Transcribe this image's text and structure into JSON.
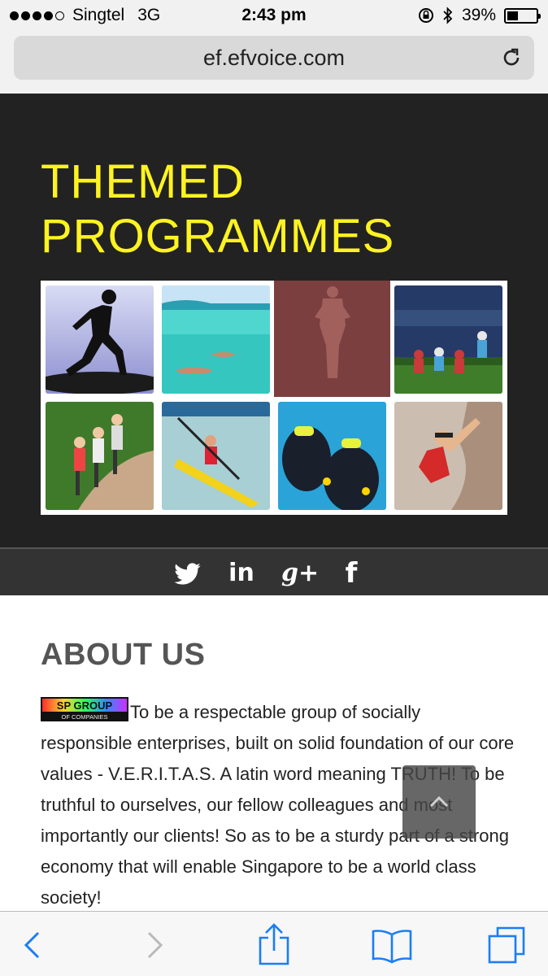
{
  "status_bar": {
    "carrier": "Singtel",
    "network": "3G",
    "time": "2:43 pm",
    "battery": "39%",
    "battery_level": 0.39
  },
  "browser": {
    "url": "ef.efvoice.com"
  },
  "hero": {
    "title_line1": "THEMED",
    "title_line2": "PROGRAMMES",
    "title_color": "#fdf321",
    "tiles": [
      {
        "subject": "running"
      },
      {
        "subject": "swimming"
      },
      {
        "subject": "yoga"
      },
      {
        "subject": "rugby"
      },
      {
        "subject": "inline-skating"
      },
      {
        "subject": "kayaking"
      },
      {
        "subject": "scuba-diving"
      },
      {
        "subject": "rock-climbing"
      }
    ]
  },
  "social": {
    "icons": [
      "twitter-icon",
      "linkedin-icon",
      "google-plus-icon",
      "facebook-icon"
    ],
    "linkedin_label": "in",
    "google_label": "g+",
    "facebook_label": "f"
  },
  "about": {
    "title": "ABOUT US",
    "logo_text_top": "SP GROUP",
    "logo_text_bottom": "OF COMPANIES",
    "body": "To be a respectable group of socially responsible enterprises, built on solid foundation of our core values - V.E.R.I.T.A.S. A latin word meaning TRUTH! To be truthful to ourselves, our fellow colleagues and most importantly our clients! So as to be a sturdy part of a strong economy that will enable Singapore to be a world class society!"
  },
  "toolbar": {
    "icons": [
      "back-icon",
      "forward-icon",
      "share-icon",
      "bookmarks-icon",
      "tabs-icon"
    ],
    "accent": "#1a7ef5"
  }
}
